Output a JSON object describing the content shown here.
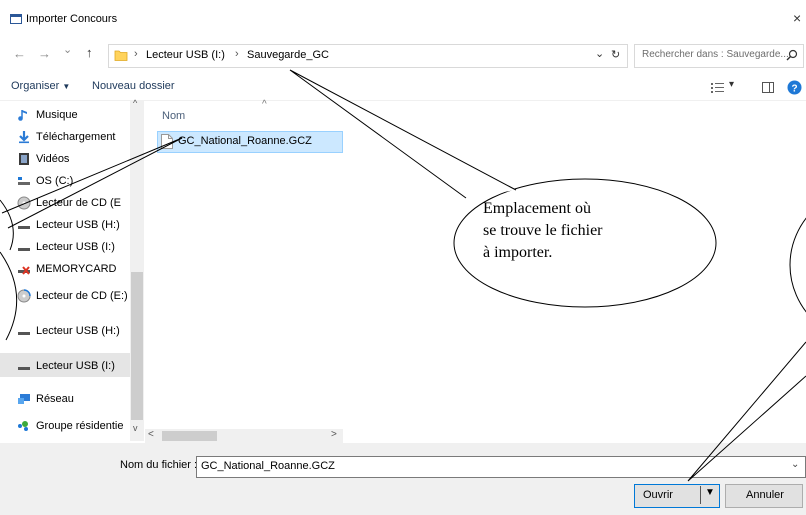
{
  "window": {
    "title": "Importer Concours",
    "close_glyph": "×"
  },
  "nav": {
    "back": "←",
    "forward": "→",
    "recent": "⌄",
    "up": "↑"
  },
  "address": {
    "separator": "›",
    "segments": [
      "Lecteur USB (I:)",
      "Sauvegarde_GC"
    ],
    "dropdown": "⌄",
    "refresh": "↻"
  },
  "search": {
    "placeholder": "Rechercher dans : Sauvegarde...",
    "icon": "search-icon"
  },
  "toolbar": {
    "organize_label": "Organiser",
    "new_folder_label": "Nouveau dossier",
    "view_dropdown": "▾"
  },
  "sidebar": {
    "items": [
      {
        "label": "Musique",
        "icon": "music-icon"
      },
      {
        "label": "Téléchargement",
        "icon": "download-icon"
      },
      {
        "label": "Vidéos",
        "icon": "video-icon"
      },
      {
        "label": "OS (C:)",
        "icon": "drive-icon"
      },
      {
        "label": "Lecteur de CD (E",
        "icon": "cd-icon"
      },
      {
        "label": "Lecteur USB (H:)",
        "icon": "usb-drive-icon"
      },
      {
        "label": "Lecteur USB (I:)",
        "icon": "usb-drive-icon"
      },
      {
        "label": "MEMORYCARD",
        "icon": "memorycard-icon"
      },
      {
        "label": "Lecteur de CD (E:)",
        "icon": "cd-icon"
      },
      {
        "label": "Lecteur USB (H:)",
        "icon": "usb-drive-icon"
      },
      {
        "label": "Lecteur USB (I:)",
        "icon": "usb-drive-icon"
      },
      {
        "label": "Réseau",
        "icon": "network-icon"
      },
      {
        "label": "Groupe résidentie",
        "icon": "homegroup-icon"
      }
    ]
  },
  "file_list": {
    "column_name": "Nom",
    "sort_glyph": "^",
    "files": [
      {
        "name": "GC_National_Roanne.GCZ",
        "icon": "file-icon"
      }
    ]
  },
  "bottom": {
    "filename_label": "Nom du fichier :",
    "filename_value": "GC_National_Roanne.GCZ",
    "open_label": "Ouvrir",
    "cancel_label": "Annuler"
  },
  "annotation": {
    "lines": [
      "Emplacement  où",
      "se trouve le fichier",
      "à importer."
    ]
  },
  "colors": {
    "selection": "#cce8ff",
    "accent": "#0078d7",
    "bottom_bg": "#f0f0f0"
  }
}
